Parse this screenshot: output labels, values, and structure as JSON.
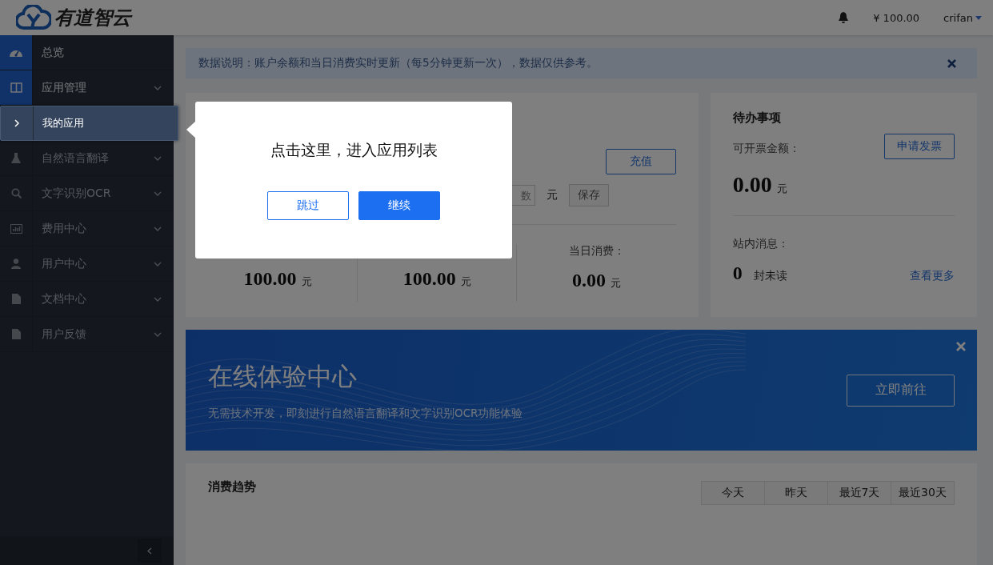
{
  "header": {
    "logo": "有道智云",
    "balance": "¥ 100.00",
    "user": "crifan"
  },
  "sidebar": {
    "items": [
      {
        "label": "总览",
        "kind": "dashboard",
        "active": true,
        "expandable": false
      },
      {
        "label": "应用管理",
        "kind": "columns",
        "active": true,
        "expandable": true,
        "children": [
          {
            "label": "我的应用",
            "highlighted": true
          }
        ]
      },
      {
        "label": "自然语言翻译",
        "kind": "flask",
        "active": false,
        "expandable": true
      },
      {
        "label": "文字识别OCR",
        "kind": "search",
        "active": false,
        "expandable": true
      },
      {
        "label": "费用中心",
        "kind": "chart",
        "active": false,
        "expandable": true
      },
      {
        "label": "用户中心",
        "kind": "user",
        "active": false,
        "expandable": true
      },
      {
        "label": "文档中心",
        "kind": "file",
        "active": false,
        "expandable": true
      },
      {
        "label": "用户反馈",
        "kind": "file",
        "active": false,
        "expandable": true
      }
    ]
  },
  "notice": {
    "text": "数据说明：账户余额和当日消费实时更新（每5分钟更新一次），数据仅供参考。"
  },
  "balance_card": {
    "recharge": "充值",
    "input_placeholder": "数",
    "unit": "元",
    "save": "保存",
    "stats": [
      {
        "value": "100.00",
        "unit": "元"
      },
      {
        "value": "100.00",
        "unit": "元"
      },
      {
        "label": "当日消费：",
        "value": "0.00",
        "unit": "元"
      }
    ]
  },
  "todo": {
    "title": "待办事项",
    "invoice_label": "可开票金额：",
    "invoice_button": "申请发票",
    "invoice_amount": "0.00",
    "invoice_unit": "元",
    "messages_label": "站内消息：",
    "messages_count": "0",
    "messages_suffix": "封未读",
    "more": "查看更多"
  },
  "promo": {
    "title": "在线体验中心",
    "subtitle": "无需技术开发，即刻进行自然语言翻译和文字识别OCR功能体验",
    "button": "立即前往"
  },
  "trend": {
    "title": "消费趋势",
    "ranges": [
      "今天",
      "昨天",
      "最近7天",
      "最近30天"
    ]
  },
  "guide": {
    "message": "点击这里，进入应用列表",
    "skip": "跳过",
    "next": "继续"
  }
}
